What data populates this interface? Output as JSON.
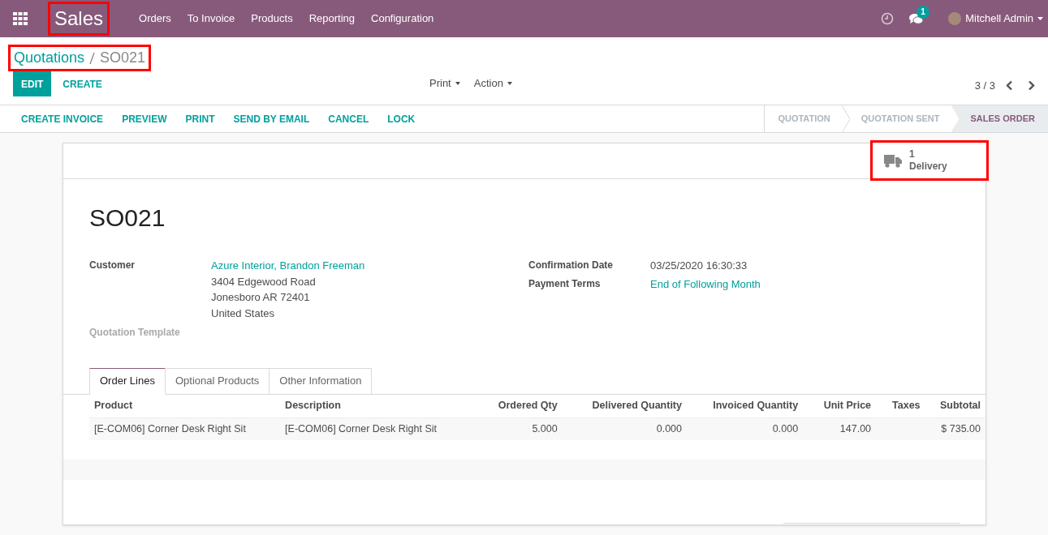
{
  "navbar": {
    "brand": {
      "label": "Sales",
      "highlighted": true
    },
    "menu": [
      "Orders",
      "To Invoice",
      "Products",
      "Reporting",
      "Configuration"
    ],
    "messages_count": "1",
    "user": "Mitchell Admin"
  },
  "breadcrumb": {
    "highlighted": true,
    "parent": "Quotations",
    "current": "SO021"
  },
  "control_buttons": [
    {
      "label": "EDIT",
      "kind": "primary"
    },
    {
      "label": "CREATE",
      "kind": "link"
    }
  ],
  "dropdowns": [
    "Print",
    "Action"
  ],
  "pager": "3 / 3",
  "header_buttons": [
    "CREATE INVOICE",
    "PREVIEW",
    "PRINT",
    "SEND BY EMAIL",
    "CANCEL",
    "LOCK"
  ],
  "stages": [
    {
      "label": "QUOTATION",
      "selected": false
    },
    {
      "label": "QUOTATION SENT",
      "selected": false
    },
    {
      "label": "SALES ORDER",
      "selected": true
    }
  ],
  "smart_button": {
    "count": "1",
    "label": "Delivery",
    "highlighted": true
  },
  "title": "SO021",
  "left_fields": [
    {
      "label": "Customer",
      "kind": "link",
      "lines": [
        "Azure Interior, Brandon Freeman",
        "3404 Edgewood Road",
        "Jonesboro AR 72401",
        "United States"
      ]
    },
    {
      "label": "Quotation Template",
      "kind": "empty"
    }
  ],
  "right_fields": [
    {
      "label": "Confirmation Date",
      "kind": "text",
      "lines": [
        "03/25/2020 16:30:33"
      ]
    },
    {
      "label": "Payment Terms",
      "kind": "link",
      "lines": [
        "End of Following Month"
      ]
    }
  ],
  "tabs": [
    {
      "label": "Order Lines",
      "selected": true
    },
    {
      "label": "Optional Products",
      "selected": false
    },
    {
      "label": "Other Information",
      "selected": false
    }
  ],
  "table": {
    "columns": [
      {
        "label": "Product",
        "kind": "text"
      },
      {
        "label": "Description",
        "kind": "text"
      },
      {
        "label": "Ordered Qty",
        "kind": "number"
      },
      {
        "label": "Delivered Quantity",
        "kind": "number"
      },
      {
        "label": "Invoiced Quantity",
        "kind": "number"
      },
      {
        "label": "Unit Price",
        "kind": "number"
      },
      {
        "label": "Taxes",
        "kind": "text"
      },
      {
        "label": "Subtotal",
        "kind": "number"
      }
    ],
    "rows": [
      [
        "[E-COM06] Corner Desk Right Sit",
        "[E-COM06] Corner Desk Right Sit",
        "5.000",
        "0.000",
        "0.000",
        "147.00",
        "",
        "$ 735.00"
      ]
    ]
  }
}
